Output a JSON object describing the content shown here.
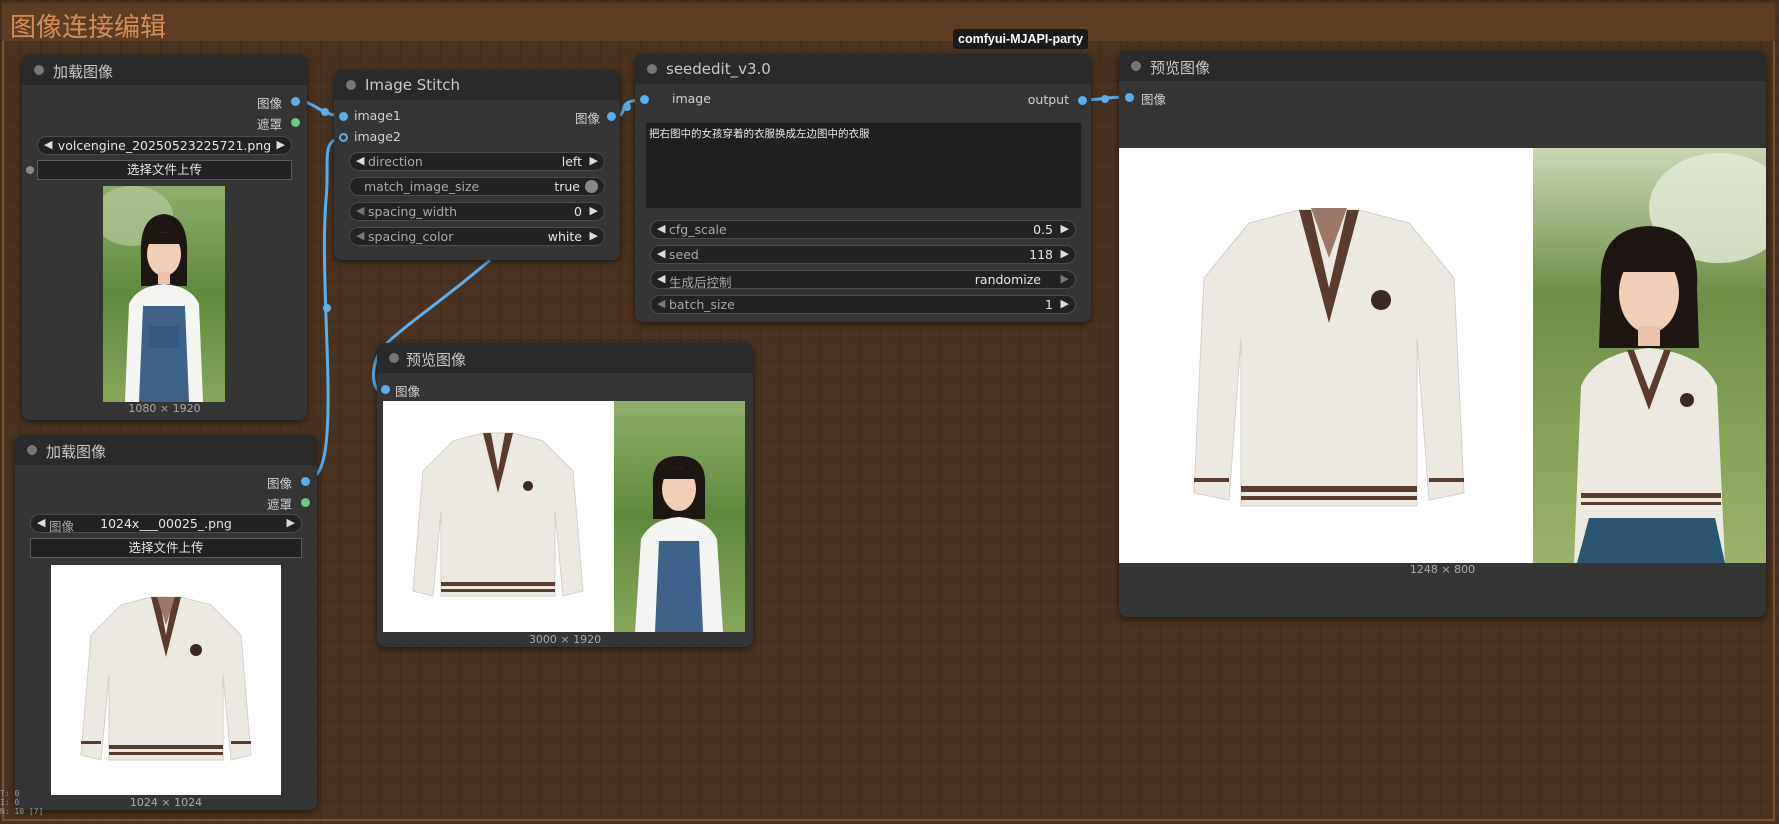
{
  "group": {
    "title": "图像连接编辑"
  },
  "tooltip": {
    "text": "comfyui-MJAPI-party"
  },
  "load_image_1": {
    "title": "加载图像",
    "out_image": "图像",
    "out_mask": "遮罩",
    "file_value": "volcengine_20250523225721.png",
    "upload_label": "选择文件上传",
    "dims": "1080 × 1920"
  },
  "load_image_2": {
    "title": "加载图像",
    "out_image": "图像",
    "out_mask": "遮罩",
    "file_label": "图像",
    "file_value": "1024x___00025_.png",
    "upload_label": "选择文件上传",
    "dims": "1024 × 1024"
  },
  "image_stitch": {
    "title": "Image Stitch",
    "in_image1": "image1",
    "in_image2": "image2",
    "out_image": "图像",
    "widgets": [
      {
        "label": "direction",
        "value": "left"
      },
      {
        "label": "match_image_size",
        "value": "true"
      },
      {
        "label": "spacing_width",
        "value": "0"
      },
      {
        "label": "spacing_color",
        "value": "white"
      }
    ]
  },
  "seededit": {
    "title": "seededit_v3.0",
    "in_image": "image",
    "out_output": "output",
    "prompt": "把右图中的女孩穿着的衣服换成左边图中的衣服",
    "widgets": [
      {
        "label": "cfg_scale",
        "value": "0.5"
      },
      {
        "label": "seed",
        "value": "118"
      },
      {
        "label": "生成后控制",
        "value": "randomize"
      },
      {
        "label": "batch_size",
        "value": "1"
      }
    ]
  },
  "preview_1": {
    "title": "预览图像",
    "in_image": "图像",
    "dims": "3000 × 1920"
  },
  "preview_2": {
    "title": "预览图像",
    "in_image": "图像",
    "dims": "1248 × 800"
  },
  "status": {
    "line1": "T: 0",
    "line2": "I: 0",
    "line3": "N: 10 [7]"
  },
  "colors": {
    "canvas_bg": "#4a3320",
    "group_title": "#d58d55",
    "link": "#5aaff0",
    "node_bg": "#353535"
  }
}
